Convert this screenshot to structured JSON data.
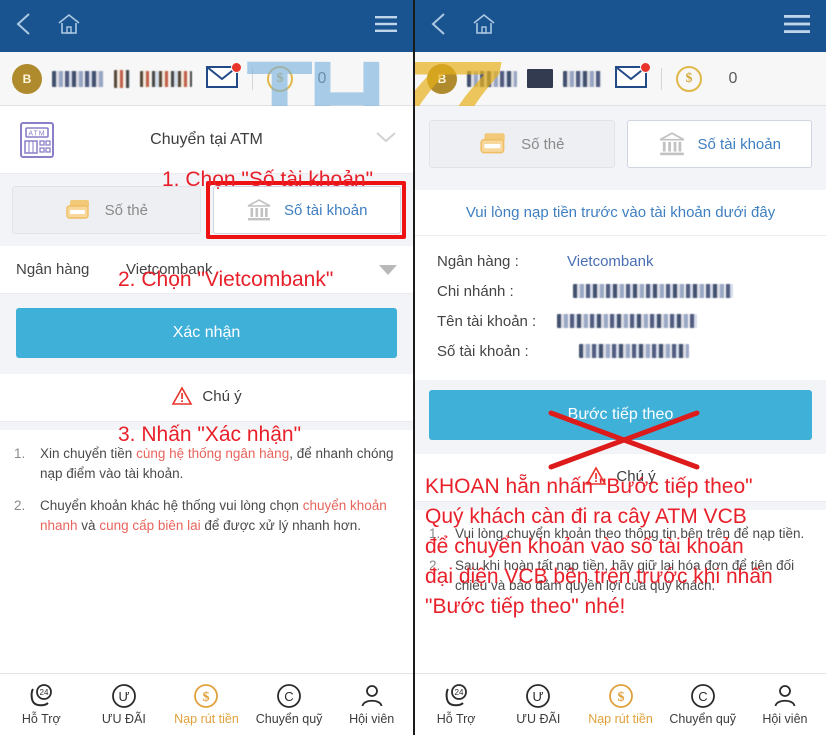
{
  "meta": {
    "watermark_left": "TH",
    "watermark_right": "77",
    "accent_blue": "#1a5490",
    "accent_button": "#3fb0d8",
    "annotation_red": "#e8202a",
    "link_blue": "#3f7fc1",
    "gold": "#e0b84a"
  },
  "left": {
    "topbar": {
      "back_icon": "chevron-left-icon",
      "home_icon": "home-icon",
      "menu_icon": "hamburger-menu-icon"
    },
    "account": {
      "avatar_letter": "B",
      "username_redacted": "█████",
      "vip_redacted": "████",
      "mail_icon": "envelope-icon",
      "mail_badge": "",
      "coin_icon": "dollar-coin-icon",
      "balance": "0"
    },
    "section": {
      "icon": "atm-machine-icon",
      "title": "Chuyển tại ATM",
      "chevron": "chevron-down-icon"
    },
    "tabs": [
      {
        "label": "Số thẻ",
        "icon": "card-stack-icon",
        "active": false
      },
      {
        "label": "Số tài khoản",
        "icon": "bank-building-icon",
        "active": true
      }
    ],
    "bank": {
      "label": "Ngân hàng",
      "value": "Vietcombank",
      "caret": "caret-down-icon"
    },
    "confirm_button": "Xác nhận",
    "annotations": {
      "step1": "1. Chọn \"Số tài khoản\"",
      "step2": "2. Chọn \"Vietcombank\"",
      "step3": "3. Nhấn \"Xác nhận\""
    },
    "attention": {
      "icon": "warning-triangle-icon",
      "label": "Chú ý"
    },
    "notes": [
      {
        "num": "1.",
        "parts": [
          {
            "text": "Xin chuyển tiền ",
            "highlight": false
          },
          {
            "text": "cùng hệ thống ngân hàng",
            "highlight": true
          },
          {
            "text": ", để nhanh chóng nạp điểm vào tài khoản.",
            "highlight": false
          }
        ]
      },
      {
        "num": "2.",
        "parts": [
          {
            "text": "Chuyển khoản khác hệ thống vui lòng chọn ",
            "highlight": false
          },
          {
            "text": "chuyển khoản nhanh",
            "highlight": true
          },
          {
            "text": " và ",
            "highlight": false
          },
          {
            "text": "cung cấp biên lai",
            "highlight": true
          },
          {
            "text": " để được xử lý nhanh hơn.",
            "highlight": false
          }
        ]
      }
    ],
    "bottomnav": [
      {
        "label": "Hỗ Trợ",
        "icon": "support-24-icon",
        "accent": false
      },
      {
        "label": "ƯU ĐÃI",
        "icon": "promo-u-icon",
        "accent": false
      },
      {
        "label": "Nạp rút tiền",
        "icon": "deposit-dollar-icon",
        "accent": true
      },
      {
        "label": "Chuyển quỹ",
        "icon": "transfer-c-icon",
        "accent": false
      },
      {
        "label": "Hội viên",
        "icon": "member-person-icon",
        "accent": false
      }
    ]
  },
  "right": {
    "topbar": {
      "back_icon": "chevron-left-icon",
      "home_icon": "home-icon",
      "menu_icon": "hamburger-menu-icon"
    },
    "account": {
      "avatar_letter": "B",
      "username_redacted": "████",
      "vip_redacted": "███",
      "mail_icon": "envelope-icon",
      "coin_icon": "dollar-coin-icon",
      "balance": "0"
    },
    "tabs": [
      {
        "label": "Số thẻ",
        "icon": "card-stack-icon",
        "active": false
      },
      {
        "label": "Số tài khoản",
        "icon": "bank-building-icon",
        "active": true
      }
    ],
    "notice": "Vui lòng nạp tiền trước vào tài khoản dưới đây",
    "info": [
      {
        "label": "Ngân hàng :",
        "value": "Vietcombank",
        "redacted": false
      },
      {
        "label": "Chi nhánh :",
        "value": "████ ████ ██",
        "redacted": true
      },
      {
        "label": "Tên tài khoản :",
        "value": "███ ██ ███",
        "redacted": true
      },
      {
        "label": "Số tài khoản :",
        "value": "████████",
        "redacted": true
      }
    ],
    "next_button": "Bước tiếp theo",
    "cross_out": "red-x-cross-out",
    "annotation_lines": [
      "KHOAN hẵn nhấn \"Bước tiếp theo\"",
      "Quý khách càn đi ra cây ATM VCB",
      "để chuyển khoản vào số tài khoản",
      "đại diện VCB bên trên trước khi nhấn",
      "\"Bước tiếp theo\" nhé!"
    ],
    "attention": {
      "icon": "warning-triangle-icon",
      "label": "Chú ý"
    },
    "notes": [
      {
        "num": "1.",
        "text": "Vui lòng chuyển khoản theo thông tin bên trên để nạp tiền."
      },
      {
        "num": "2.",
        "text": "Sau khi hoàn tất nạp tiền, hãy giữ lại hóa đơn để tiện đối chiếu và bảo đảm quyền lợi của quý khách."
      }
    ],
    "bottomnav": [
      {
        "label": "Hỗ Trợ",
        "icon": "support-24-icon",
        "accent": false
      },
      {
        "label": "ƯU ĐÃI",
        "icon": "promo-u-icon",
        "accent": false
      },
      {
        "label": "Nạp rút tiền",
        "icon": "deposit-dollar-icon",
        "accent": true
      },
      {
        "label": "Chuyển quỹ",
        "icon": "transfer-c-icon",
        "accent": false
      },
      {
        "label": "Hội viên",
        "icon": "member-person-icon",
        "accent": false
      }
    ]
  }
}
